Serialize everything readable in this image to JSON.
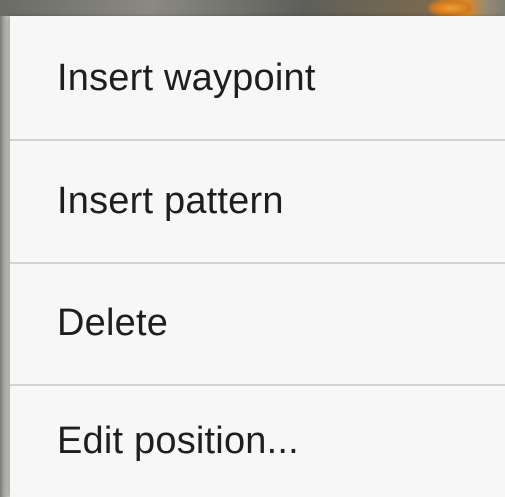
{
  "context_menu": {
    "items": [
      {
        "label": "Insert waypoint"
      },
      {
        "label": "Insert pattern"
      },
      {
        "label": "Delete"
      },
      {
        "label": "Edit position..."
      }
    ]
  },
  "colors": {
    "menu_background": "#f7f7f7",
    "divider": "#d2d2d2",
    "text": "#1e1e1e",
    "accent_marker": "#e08a20"
  }
}
